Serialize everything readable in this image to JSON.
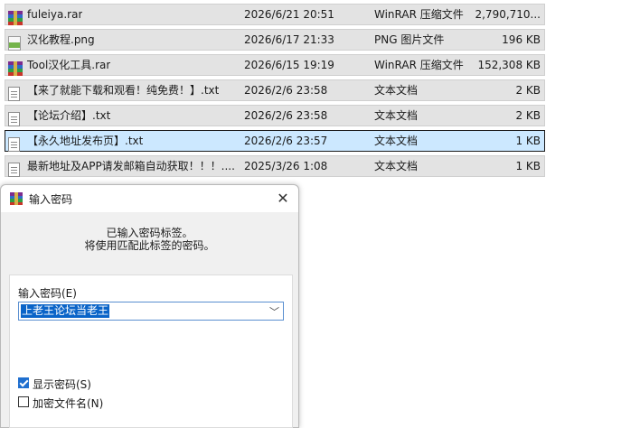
{
  "files": [
    {
      "icon": "rar-archive-icon",
      "name": "fuleiya.rar",
      "date": "2026/6/21 20:51",
      "type": "WinRAR 压缩文件",
      "size": "2,790,710...",
      "selected": false
    },
    {
      "icon": "png-image-icon",
      "name": "汉化教程.png",
      "date": "2026/6/17 21:33",
      "type": "PNG 图片文件",
      "size": "196 KB",
      "selected": false
    },
    {
      "icon": "rar-archive-icon",
      "name": "Tool汉化工具.rar",
      "date": "2026/6/15 19:19",
      "type": "WinRAR 压缩文件",
      "size": "152,308 KB",
      "selected": false
    },
    {
      "icon": "text-file-icon",
      "name": "【来了就能下载和观看！纯免费！】.txt",
      "date": "2026/2/6 23:58",
      "type": "文本文档",
      "size": "2 KB",
      "selected": false
    },
    {
      "icon": "text-file-icon",
      "name": "【论坛介绍】.txt",
      "date": "2026/2/6 23:58",
      "type": "文本文档",
      "size": "2 KB",
      "selected": false
    },
    {
      "icon": "text-file-icon",
      "name": "【永久地址发布页】.txt",
      "date": "2026/2/6 23:57",
      "type": "文本文档",
      "size": "1 KB",
      "selected": true
    },
    {
      "icon": "text-file-icon",
      "name": "最新地址及APP请发邮箱自动获取！！！....",
      "date": "2025/3/26 1:08",
      "type": "文本文档",
      "size": "1 KB",
      "selected": false
    }
  ],
  "dialog": {
    "title": "输入密码",
    "message_line1": "已输入密码标签。",
    "message_line2": "将使用匹配此标签的密码。",
    "password_label": "输入密码(E)",
    "password_value": "上老王论坛当老王",
    "show_password": {
      "label": "显示密码(S)",
      "checked": true
    },
    "encrypt_filenames": {
      "label": "加密文件名(N)",
      "checked": false
    }
  },
  "colors": {
    "selected_row": "#cce8ff",
    "row_bg": "#e3e3e3",
    "accent": "#1f6fcf"
  }
}
